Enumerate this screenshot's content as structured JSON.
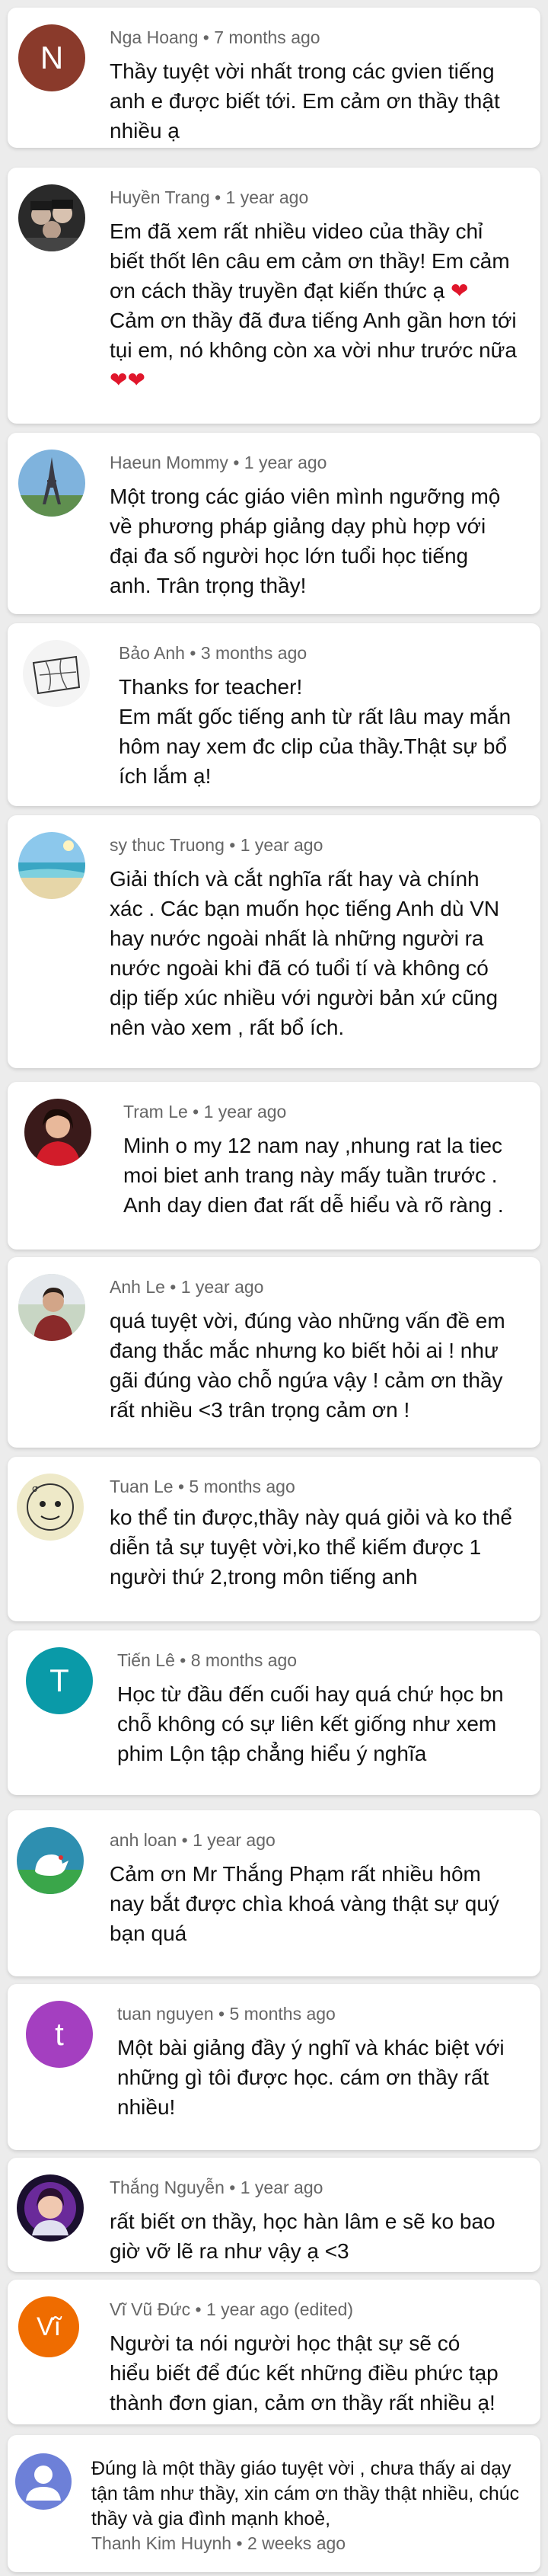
{
  "comments": [
    {
      "author": "Nga Hoang",
      "time": "7 months ago",
      "edited": "",
      "text": [
        "Thầy tuyệt vời nhất trong các gvien tiếng",
        "anh e được biết tới. Em cảm ơn thầy thật",
        "nhiều ạ"
      ],
      "avatar_letter": "N",
      "avatar_color": "#8a3a2b"
    },
    {
      "author": "Huyền Trang",
      "time": "1 year ago",
      "edited": "",
      "text": [
        "Em đã xem rất nhiều video của thầy chỉ",
        "biết thốt lên câu em cảm ơn thầy! Em cảm",
        "ơn cách thầy truyền đạt kiến thức ạ",
        "Cảm ơn thầy đã đưa tiếng Anh gần hơn tới",
        "tụi em, nó không còn xa vời như trước nữa",
        ""
      ],
      "emoji_heart": "❤",
      "emoji_hearts": "❤❤",
      "avatar_icon": "group-photo-icon"
    },
    {
      "author": "Haeun Mommy",
      "time": "1 year ago",
      "edited": "",
      "text": [
        "Một trong các giáo viên mình ngưỡng mộ",
        "về phương pháp giảng dạy phù hợp với",
        "đại đa số người học lớn tuổi học tiếng",
        "anh. Trân trọng thầy!"
      ],
      "avatar_icon": "eiffel-tower-icon"
    },
    {
      "author": "Bảo Anh",
      "time": "3 months ago",
      "edited": "",
      "text": [
        "Thanks for teacher!",
        "Em mất gốc tiếng anh từ rất lâu may mắn",
        "hôm nay xem đc clip của thầy.Thật sự bổ",
        "ích lắm ạ!"
      ],
      "avatar_icon": "sketch-icon"
    },
    {
      "author": "sy thuc Truong",
      "time": "1 year ago",
      "edited": "",
      "text": [
        "Giải thích và cắt nghĩa rất hay và chính",
        "xác . Các bạn muốn học tiếng Anh dù VN",
        "hay nước ngoài nhất là những người ra",
        "nước ngoài khi đã có tuổi tí và không có",
        "dịp tiếp xúc nhiều với người bản xứ cũng",
        "nên vào xem , rất bổ ích."
      ],
      "avatar_icon": "beach-icon"
    },
    {
      "author": "Tram Le",
      "time": "1 year ago",
      "edited": "",
      "text": [
        "Minh o my 12 nam nay ,nhung rat la tiec",
        "moi biet anh trang này mấy tuần trước .",
        "Anh day dien đat rất dễ hiểu và rõ ràng ."
      ],
      "avatar_icon": "woman-red-icon"
    },
    {
      "author": "Anh Le",
      "time": "1 year ago",
      "edited": "",
      "text": [
        "quá tuyệt vời, đúng vào những vấn đề em",
        "đang thắc mắc nhưng ko biết hỏi ai ! như",
        "gãi đúng vào chỗ ngứa vậy ! cảm ơn thầy",
        "rất nhiều <3 trân trọng cảm ơn !"
      ],
      "avatar_icon": "man-outdoor-icon"
    },
    {
      "author": "Tuan Le",
      "time": "5 months ago",
      "edited": "",
      "text": [
        "ko thể tin được,thầy này quá giỏi và ko thể",
        "diễn tả sự tuyệt vời,ko thể kiếm được 1",
        "người thứ 2,trong môn tiếng anh"
      ],
      "avatar_icon": "doodle-face-icon"
    },
    {
      "author": "Tiến Lê",
      "time": "8 months ago",
      "edited": "",
      "text": [
        "Học từ đầu đến cuối hay quá chứ học bn",
        "chỗ không có sự liên kết giống như xem",
        "phim Lộn tập chẳng hiểu ý nghĩa"
      ],
      "avatar_letter": "T",
      "avatar_color": "#0a9aa8"
    },
    {
      "author": "anh loan",
      "time": "1 year ago",
      "edited": "",
      "text": [
        "Cảm ơn Mr Thắng Phạm rất nhiều hôm",
        "nay bắt được chìa khoá vàng thật sự quý",
        "bạn quá"
      ],
      "avatar_icon": "chicken-logo-icon"
    },
    {
      "author": "tuan nguyen",
      "time": "5 months ago",
      "edited": "",
      "text": [
        "Một bài giảng đầy ý nghĩ và khác biệt với",
        "những gì tôi được học. cám ơn thầy rất",
        "nhiều!"
      ],
      "avatar_letter": "t",
      "avatar_color": "#a43fc0"
    },
    {
      "author": "Thắng Nguyễn",
      "time": "1 year ago",
      "edited": "",
      "text": [
        "rất biết ơn thầy, học hàn lâm e sẽ ko bao",
        "giờ vỡ lẽ ra như vậy ạ <3"
      ],
      "avatar_icon": "girl-purple-icon"
    },
    {
      "author": "Vĩ Vũ Đức",
      "time": "1 year ago",
      "edited": "(edited)",
      "text": [
        "Người ta nói người học thật sự sẽ có",
        "hiểu biết để đúc kết những điều phức tạp",
        "thành đơn gian, cảm ơn thầy rất nhiều ạ!"
      ],
      "avatar_letter": "Vĩ",
      "avatar_color": "#ef6c00"
    },
    {
      "author": "Thanh Kim Huynh",
      "time": "2 weeks ago",
      "edited": "",
      "text": [
        "Đúng là một thầy giáo tuyệt vời , chưa thấy ai dạy",
        "tận tâm như thầy, xin cám ơn thầy thật nhiều, chúc",
        "thầy và gia đình mạnh khoẻ,"
      ],
      "avatar_icon": "default-user-icon",
      "avatar_color": "#6d80d8"
    }
  ],
  "separator": "•"
}
